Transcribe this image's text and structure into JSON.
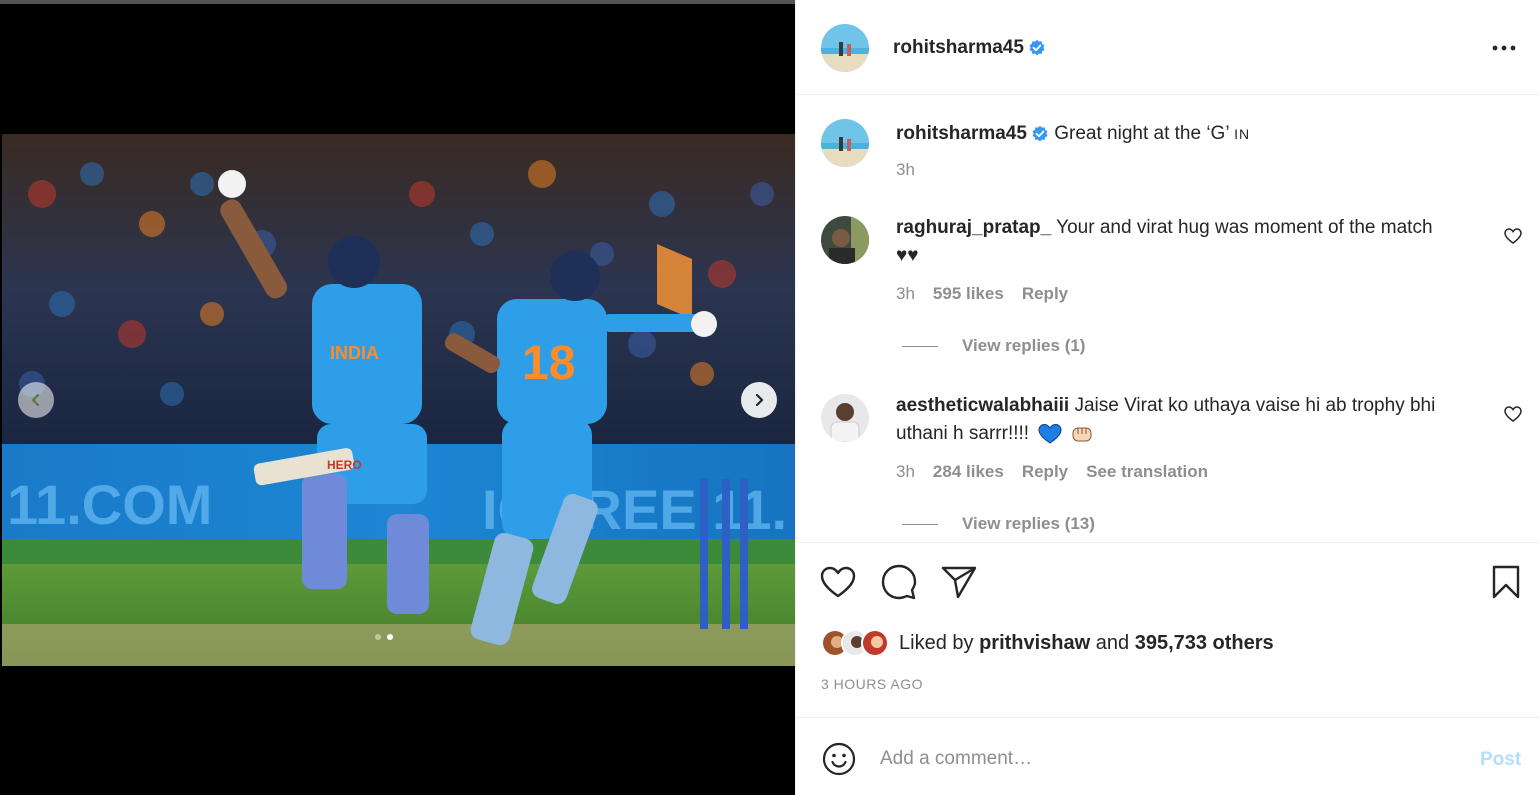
{
  "post": {
    "username": "rohitsharma45",
    "verified": true,
    "caption": "Great night at the ‘G’",
    "caption_flag": "IN",
    "caption_time": "3h",
    "more_icon": "more-horizontal-icon"
  },
  "comments": [
    {
      "username": "raghuraj_pratap_",
      "text_line1": "Your and virat hug was moment of the match",
      "text_line2": "♥♥",
      "time": "3h",
      "likes": "595 likes",
      "reply_label": "Reply",
      "view_replies": "View replies (1)"
    },
    {
      "username": "aestheticwalabhaiii",
      "text_line1": "Jaise Virat ko uthaya vaise hi ab trophy bhi",
      "text_line2": "uthani h sarrr!!!!",
      "emojis": [
        "blue-heart-icon",
        "fist-bump-icon"
      ],
      "time": "3h",
      "likes": "284 likes",
      "reply_label": "Reply",
      "translation_label": "See translation",
      "view_replies": "View replies (13)"
    }
  ],
  "actions": {
    "icons": [
      "heart-icon",
      "comment-icon",
      "share-icon",
      "bookmark-icon"
    ]
  },
  "likes": {
    "prefix": "Liked by",
    "liker": "prithvishaw",
    "joiner": "and",
    "others": "395,733 others"
  },
  "timestamp": "3 HOURS AGO",
  "add_comment": {
    "placeholder": "Add a comment…",
    "post_label": "Post"
  },
  "colors": {
    "verified_blue": "#3897f0",
    "jersey_blue": "#2e9ee8",
    "post_disabled": "#b2dffc",
    "meta_grey": "#8e8e8e"
  },
  "carousel": {
    "slide_count": 2,
    "active_slide": 2
  }
}
